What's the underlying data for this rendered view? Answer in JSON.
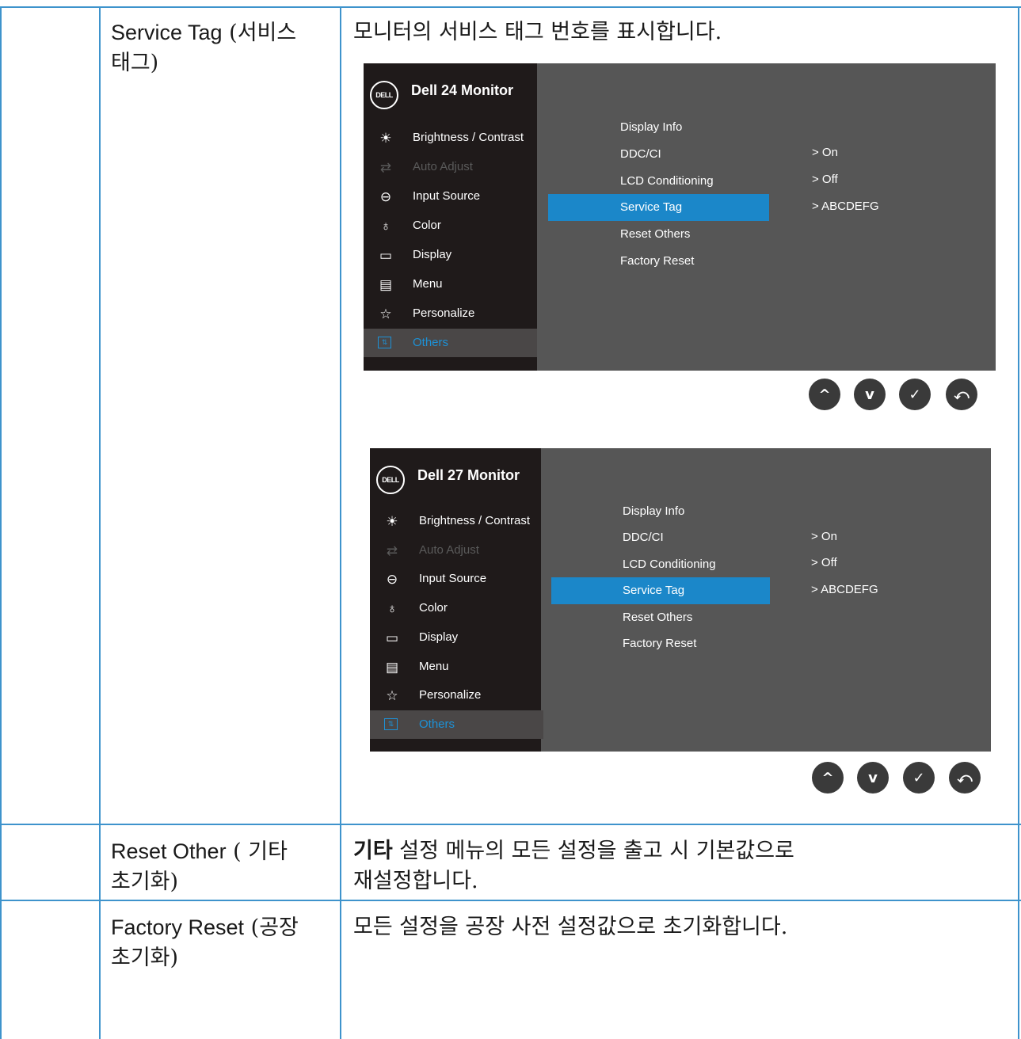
{
  "rows": [
    {
      "name_en": "Service Tag",
      "name_ko_1": "(서비스",
      "name_ko_2": "태그)",
      "description": "모니터의 서비스 태그 번호를 표시합니다."
    },
    {
      "name_en": "Reset Other",
      "name_ko_1": "( 기타",
      "name_ko_2": "초기화)",
      "description_bold": "기타",
      "description_line1": "설정 메뉴의 모든 설정을 출고 시 기본값으로",
      "description_line2": "재설정합니다."
    },
    {
      "name_en": "Factory Reset",
      "name_ko_1": "(공장",
      "name_ko_2": "초기화)",
      "description": "모든 설정을 공장 사전 설정값으로 초기화합니다."
    }
  ],
  "osd_24": {
    "logo": "DELL",
    "title": "Dell 24 Monitor",
    "menu": [
      {
        "label": "Brightness / Contrast",
        "icon": "brightness-icon"
      },
      {
        "label": "Auto Adjust",
        "icon": "auto-adjust-icon",
        "state": "disabled"
      },
      {
        "label": "Input Source",
        "icon": "input-source-icon"
      },
      {
        "label": "Color",
        "icon": "color-icon"
      },
      {
        "label": "Display",
        "icon": "display-icon"
      },
      {
        "label": "Menu",
        "icon": "menu-icon"
      },
      {
        "label": "Personalize",
        "icon": "star-icon"
      },
      {
        "label": "Others",
        "icon": "others-icon",
        "state": "active"
      }
    ],
    "submenu": [
      "Display Info",
      "DDC/CI",
      "LCD Conditioning",
      "Service Tag",
      "Reset Others",
      "Factory Reset"
    ],
    "selected": "Service Tag",
    "values": [
      "> On",
      "> Off",
      "> ABCDEFG"
    ]
  },
  "osd_27": {
    "logo": "DELL",
    "title": "Dell 27 Monitor",
    "menu": [
      {
        "label": "Brightness / Contrast",
        "icon": "brightness-icon"
      },
      {
        "label": "Auto Adjust",
        "icon": "auto-adjust-icon",
        "state": "disabled"
      },
      {
        "label": "Input Source",
        "icon": "input-source-icon"
      },
      {
        "label": "Color",
        "icon": "color-icon"
      },
      {
        "label": "Display",
        "icon": "display-icon"
      },
      {
        "label": "Menu",
        "icon": "menu-icon"
      },
      {
        "label": "Personalize",
        "icon": "star-icon"
      },
      {
        "label": "Others",
        "icon": "others-icon",
        "state": "active"
      }
    ],
    "submenu": [
      "Display Info",
      "DDC/CI",
      "LCD Conditioning",
      "Service Tag",
      "Reset Others",
      "Factory Reset"
    ],
    "selected": "Service Tag",
    "values": [
      "> On",
      "> Off",
      "> ABCDEFG"
    ]
  },
  "buttons": [
    {
      "icon": "up-arrow-icon"
    },
    {
      "icon": "down-arrow-icon"
    },
    {
      "icon": "check-icon"
    },
    {
      "icon": "back-icon"
    }
  ],
  "colors": {
    "table_border": "#3e93cc",
    "osd_sidebar": "#1f1a1a",
    "osd_panel": "#565656",
    "osd_selection": "#1b87c9",
    "osd_active_text": "#1d91d6",
    "button_fill": "#3a3a3a"
  }
}
